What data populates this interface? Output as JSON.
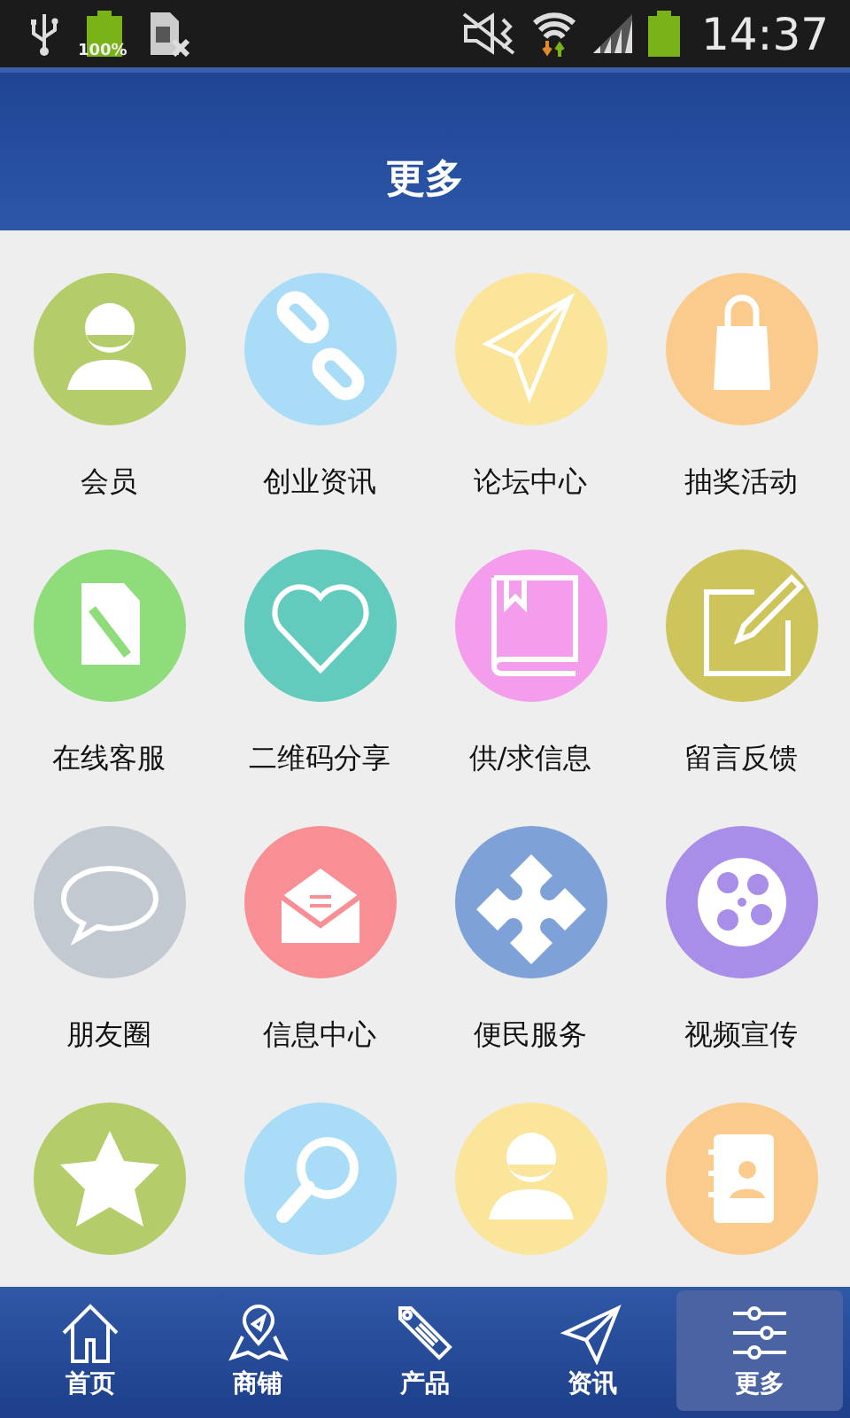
{
  "status_bar": {
    "battery_label": "100%",
    "time": "14:37"
  },
  "header": {
    "title": "更多"
  },
  "grid": [
    {
      "label": "会员",
      "color": "#b5cc6a"
    },
    {
      "label": "创业资讯",
      "color": "#a9dcf7"
    },
    {
      "label": "论坛中心",
      "color": "#fbe59b"
    },
    {
      "label": "抽奖活动",
      "color": "#fbcb8e"
    },
    {
      "label": "在线客服",
      "color": "#8fdc7a"
    },
    {
      "label": "二维码分享",
      "color": "#63cbbd"
    },
    {
      "label": "供/求信息",
      "color": "#f59ded"
    },
    {
      "label": "留言反馈",
      "color": "#cdc55c"
    },
    {
      "label": "朋友圈",
      "color": "#c3c9d0"
    },
    {
      "label": "信息中心",
      "color": "#f78f95"
    },
    {
      "label": "便民服务",
      "color": "#7ea2d8"
    },
    {
      "label": "视频宣传",
      "color": "#a88ee8"
    },
    {
      "color": "#b5cc6a"
    },
    {
      "color": "#a9dcf7"
    },
    {
      "color": "#fbe59b"
    },
    {
      "color": "#fbcb8e"
    }
  ],
  "tab_bar": [
    {
      "label": "首页",
      "selected": false
    },
    {
      "label": "商铺",
      "selected": false
    },
    {
      "label": "产品",
      "selected": false
    },
    {
      "label": "资讯",
      "selected": false
    },
    {
      "label": "更多",
      "selected": true
    }
  ]
}
